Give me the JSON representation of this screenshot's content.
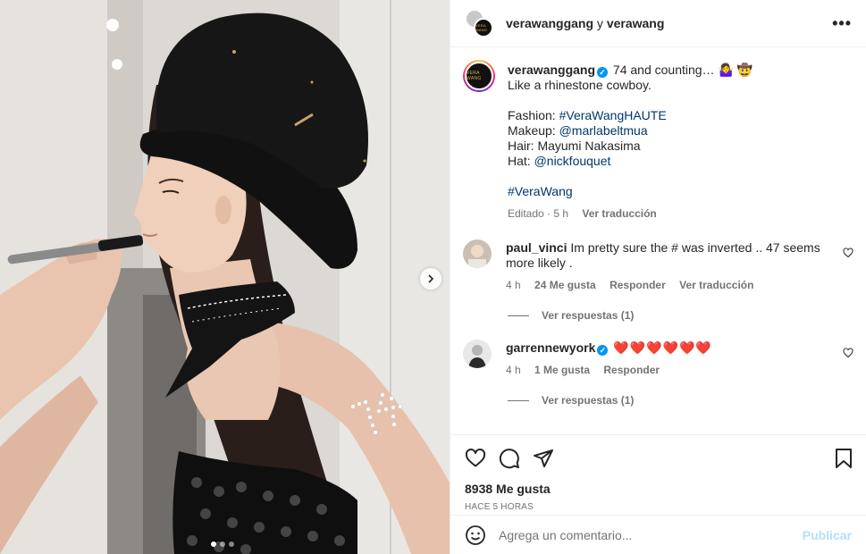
{
  "header": {
    "user1": "verawanggang",
    "joiner": "y",
    "user2": "verawang",
    "more": "•••",
    "avatar_text": "VERA WANG"
  },
  "caption": {
    "username": "verawanggang",
    "verified": "✓",
    "first_line": " 74 and counting… 🤷‍♀️ 🤠",
    "line2": "Like a rhinestone cowboy.",
    "fashion_label": "Fashion: ",
    "fashion_link": "#VeraWangHAUTE",
    "makeup_label": "Makeup: ",
    "makeup_link": "@marlabeltmua",
    "hair": "Hair: Mayumi Nakasima",
    "hat_label": "Hat: ",
    "hat_link": "@nickfouquet",
    "tag": "#VeraWang",
    "edited": "Editado · 5 h",
    "see_translation": "Ver traducción"
  },
  "comments": [
    {
      "username": "paul_vinci",
      "text": "Im pretty sure the # was inverted .. 47 seems more likely .",
      "time": "4 h",
      "likes": "24 Me gusta",
      "reply": "Responder",
      "translate": "Ver traducción",
      "replies": "Ver respuestas (1)"
    },
    {
      "username": "garrennewyork",
      "verified": "✓",
      "text": "❤️❤️❤️❤️❤️❤️",
      "time": "4 h",
      "likes": "1 Me gusta",
      "reply": "Responder",
      "replies": "Ver respuestas (1)"
    }
  ],
  "stats": {
    "likes": "8938 Me gusta",
    "ago": "HACE 5 HORAS"
  },
  "compose": {
    "placeholder": "Agrega un comentario...",
    "publish": "Publicar"
  },
  "carousel": {
    "count": 3,
    "active": 0
  },
  "icons": {
    "like": "heart-icon",
    "comment": "comment-icon",
    "share": "paper-plane-icon",
    "save": "bookmark-icon",
    "emoji": "emoji-icon",
    "next": "chevron-right-icon"
  },
  "colors": {
    "link": "#00376b",
    "verified": "#0095f6",
    "heart": "#ed4956",
    "publish": "#b2dffc"
  }
}
